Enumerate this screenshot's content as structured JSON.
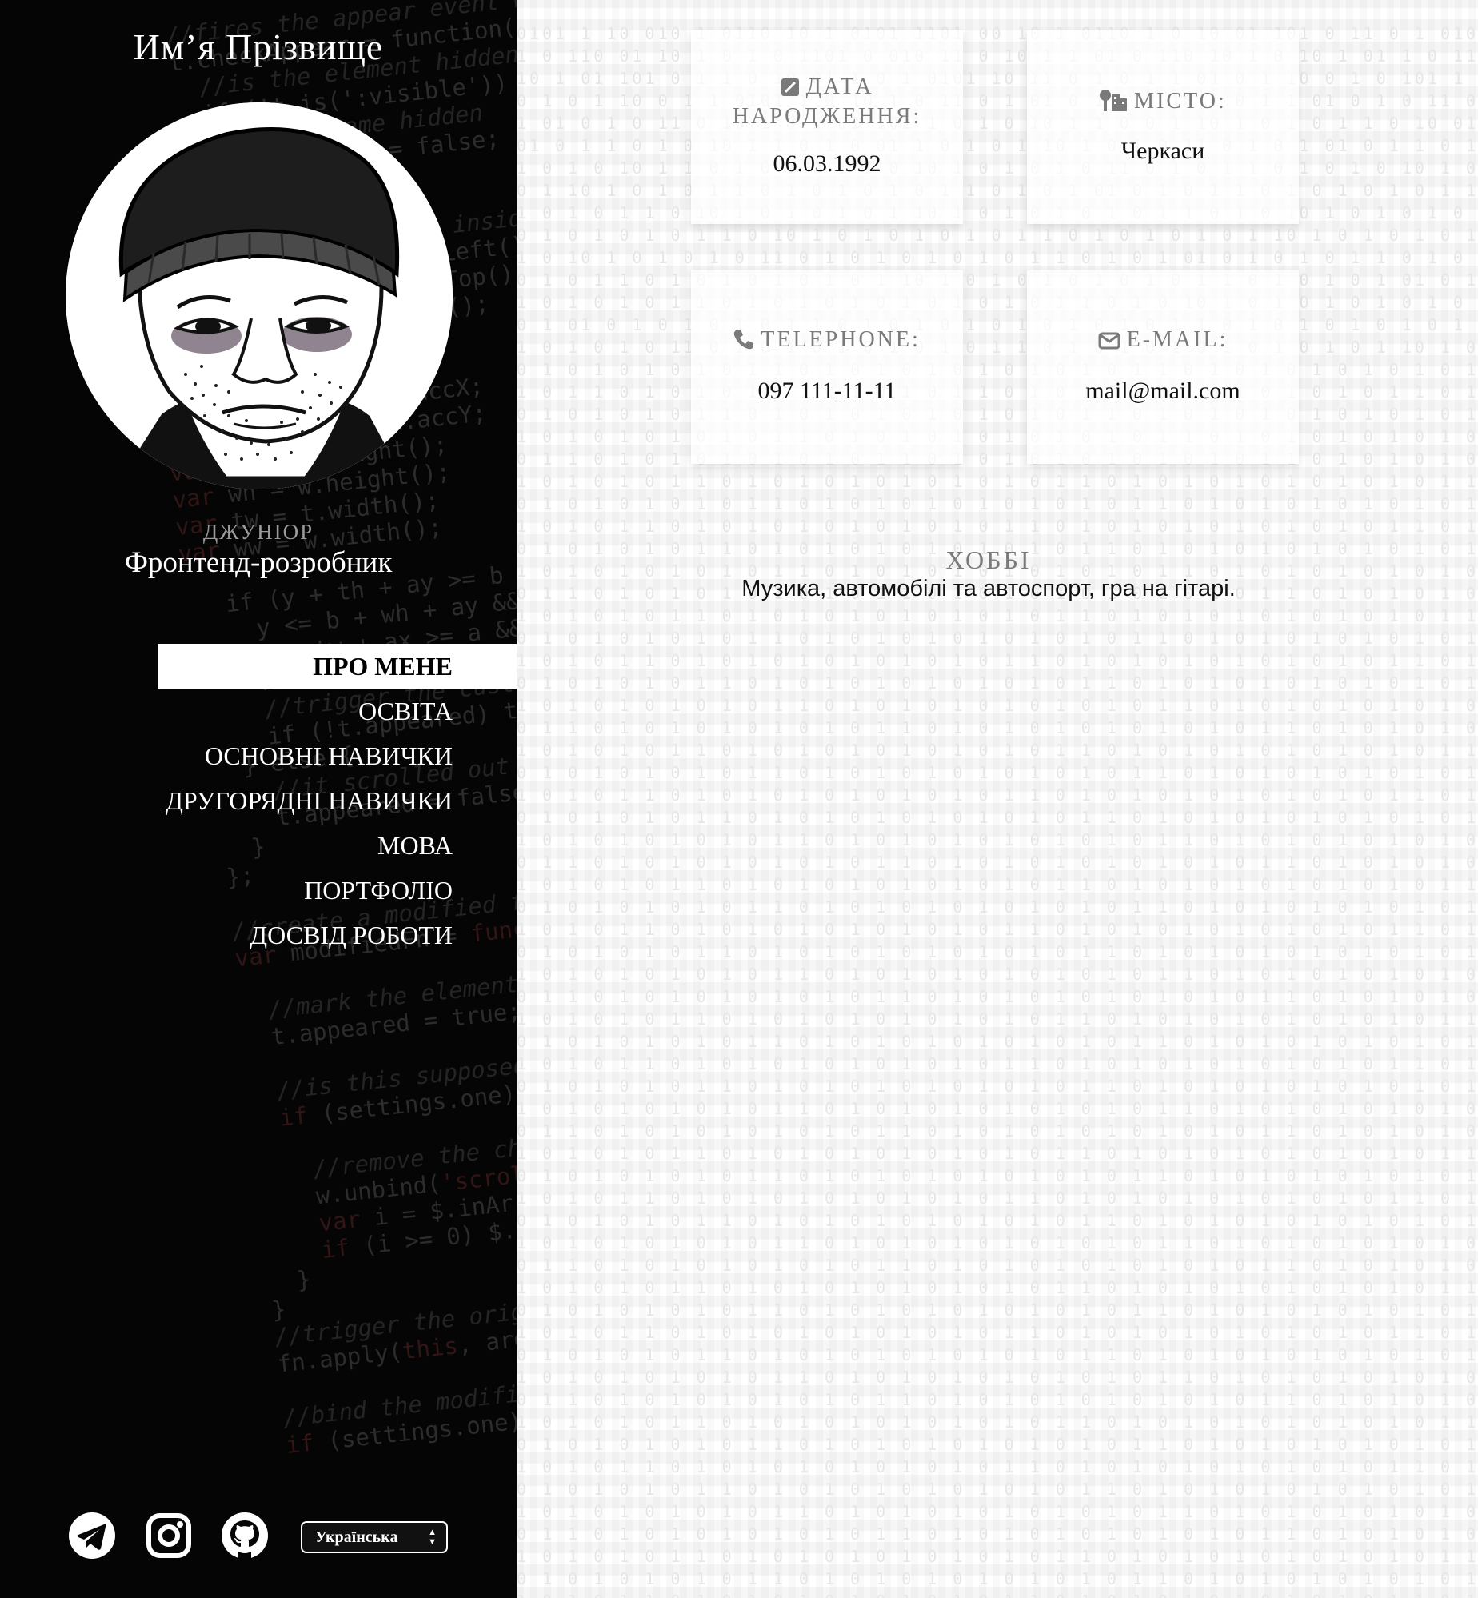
{
  "profile": {
    "name": "Им’я Прізвище",
    "level": "ДЖУНІОР",
    "position": "Фронтенд-розробник"
  },
  "nav": {
    "items": [
      {
        "label": "ПРО МЕНЕ",
        "active": true
      },
      {
        "label": "ОСВІТА"
      },
      {
        "label": "ОСНОВНІ НАВИЧКИ"
      },
      {
        "label": "ДРУГОРЯДНІ НАВИЧКИ"
      },
      {
        "label": "МОВА"
      },
      {
        "label": "ПОРТФОЛІО"
      },
      {
        "label": "ДОСВІД РОБОТИ"
      }
    ]
  },
  "social": {
    "icons": [
      "telegram-icon",
      "instagram-icon",
      "github-icon"
    ],
    "language_select": "Українська"
  },
  "info": {
    "birth_label": "ДАТА НАРОДЖЕННЯ:",
    "birth_value": "06.03.1992",
    "city_label": "МІСТО:",
    "city_value": "Черкаси",
    "phone_label": "TELEPHONE:",
    "phone_value": "097 111-11-11",
    "email_label": "E-MAIL:",
    "email_value": "mail@mail.com"
  },
  "hobby": {
    "title": "ХОББІ",
    "text": "Музика, автомобілі та автоспорт, гра на гітарі."
  },
  "colors": {
    "sidebar_bg": "#050505",
    "active_nav_bg": "#ffffff",
    "label_gray": "#7a7a7a"
  }
}
